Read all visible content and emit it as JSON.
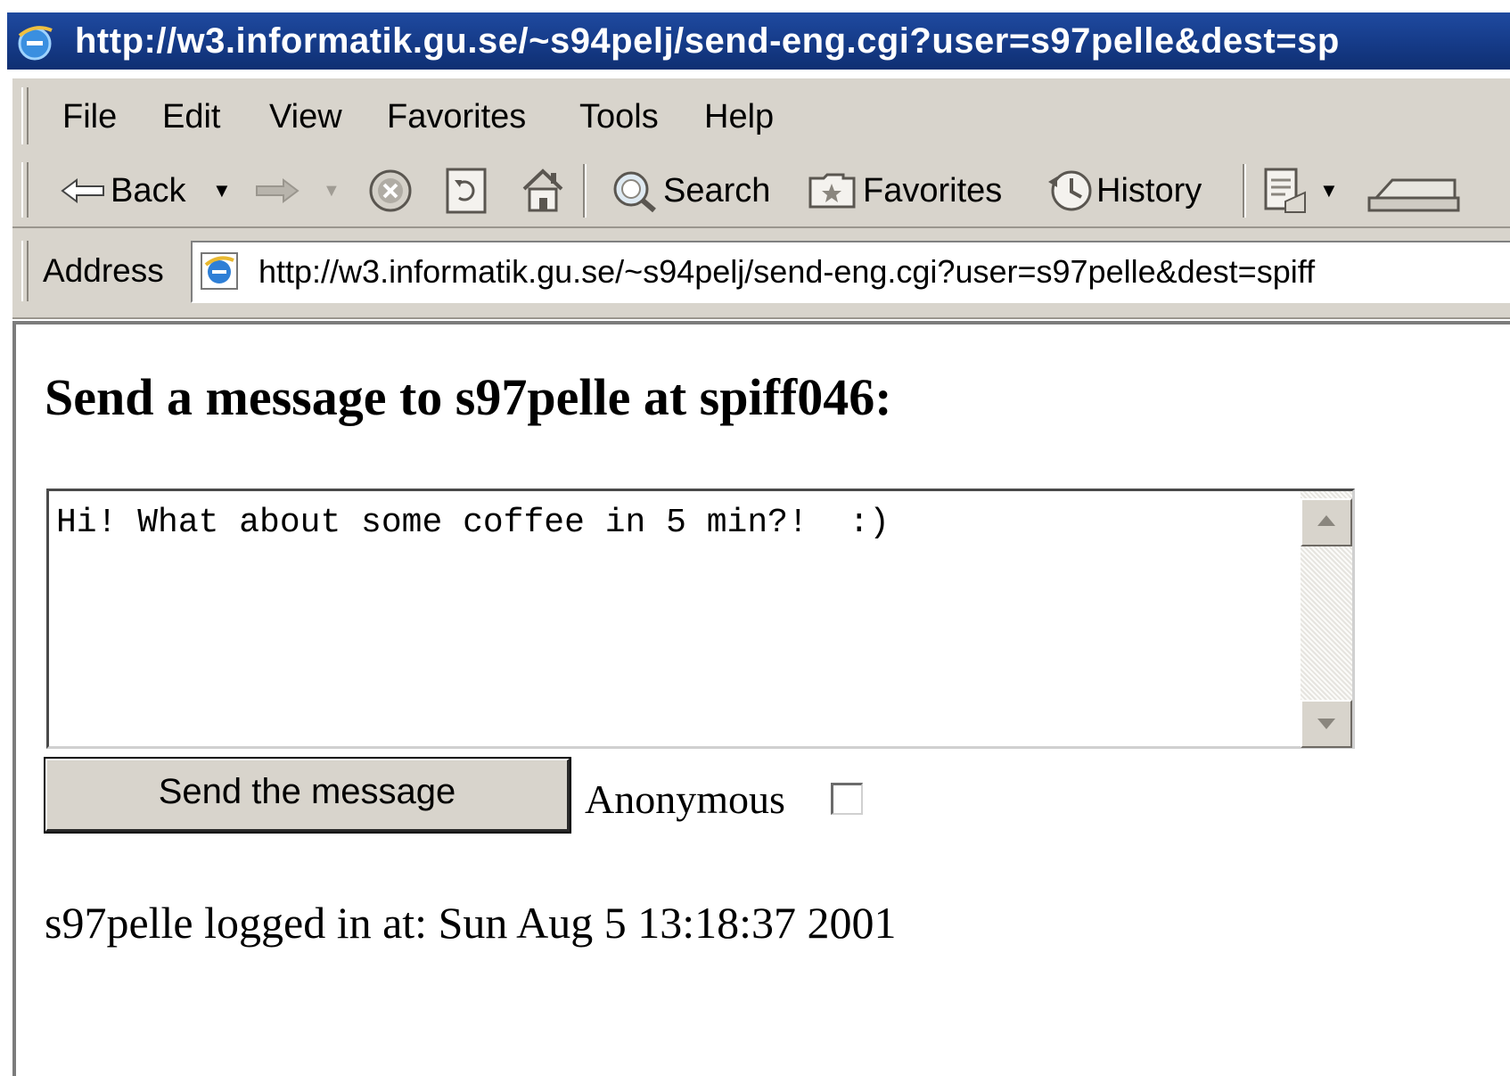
{
  "window": {
    "title": "http://w3.informatik.gu.se/~s94pelj/send-eng.cgi?user=s97pelle&dest=sp"
  },
  "menu": [
    "File",
    "Edit",
    "View",
    "Favorites",
    "Tools",
    "Help"
  ],
  "toolbar": {
    "back_label": "Back",
    "search_label": "Search",
    "favorites_label": "Favorites",
    "history_label": "History"
  },
  "address": {
    "label": "Address",
    "url": "http://w3.informatik.gu.se/~s94pelj/send-eng.cgi?user=s97pelle&dest=spiff"
  },
  "page": {
    "heading": "Send a message to s97pelle at spiff046:",
    "message_text": "Hi! What about some coffee in 5 min?!  :)",
    "send_button_label": "Send the message",
    "anonymous_label": "Anonymous",
    "anonymous_checked": false,
    "login_status": "s97pelle logged in at: Sun Aug 5 13:18:37 2001"
  }
}
